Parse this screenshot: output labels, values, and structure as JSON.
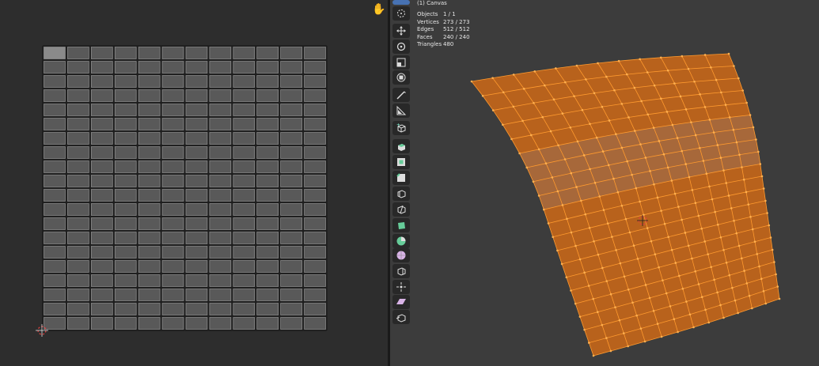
{
  "uv_editor": {
    "grid_columns": 12,
    "grid_rows": 20,
    "tool": "hand-icon"
  },
  "viewport": {
    "object_name": "(1) Canvas",
    "stats": [
      {
        "label": "Objects",
        "value": "1 / 1"
      },
      {
        "label": "Vertices",
        "value": "273 / 273"
      },
      {
        "label": "Edges",
        "value": "512 / 512"
      },
      {
        "label": "Faces",
        "value": "240 / 240"
      },
      {
        "label": "Triangles",
        "value": "480"
      }
    ],
    "mesh_color": "#b8621c",
    "wire_color": "#ff9a2e",
    "mesh_columns": 12,
    "mesh_rows": 20
  },
  "toolbar": {
    "tools": [
      "select-box-icon",
      "cursor-icon",
      "move-icon",
      "rotate-icon",
      "scale-icon",
      "transform-icon",
      "annotate-icon",
      "measure-icon",
      "add-cube-icon",
      "extrude-icon",
      "inset-icon",
      "bevel-icon",
      "loop-cut-icon",
      "knife-icon",
      "poly-build-icon",
      "spin-icon",
      "smooth-icon",
      "edge-slide-icon",
      "shrink-fatten-icon",
      "shear-icon",
      "rip-icon"
    ]
  },
  "colors": {
    "uv_background": "#2d2d2d",
    "viewport_background": "#3c3c3c",
    "active_tool": "#4772b3"
  }
}
